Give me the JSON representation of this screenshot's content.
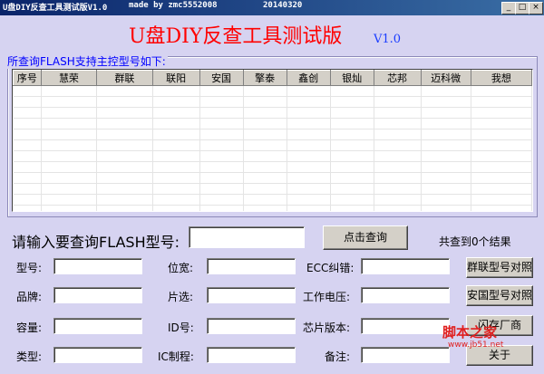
{
  "window": {
    "title": "U盘DIY反查工具测试版V1.0",
    "made_by": "made by zmc5552008",
    "date": "20140320",
    "min_glyph": "_",
    "max_glyph": "□",
    "close_glyph": "×"
  },
  "header": {
    "title": "U盘DIY反查工具测试版",
    "version": "V1.0"
  },
  "list": {
    "label": "所查询FLASH支持主控型号如下:",
    "columns": [
      "序号",
      "慧荣",
      "群联",
      "联阳",
      "安国",
      "擎泰",
      "鑫创",
      "银灿",
      "芯邦",
      "迈科微",
      "我想"
    ]
  },
  "query": {
    "prompt": "请输入要查询FLASH型号:",
    "input_value": "",
    "button": "点击查询",
    "result": "共查到0个结果"
  },
  "fields": {
    "model": "型号:",
    "width": "位宽:",
    "ecc": "ECC纠错:",
    "brand": "品牌:",
    "chip_select": "片选:",
    "voltage": "工作电压:",
    "capacity": "容量:",
    "id": "ID号:",
    "chip_version": "芯片版本:",
    "type": "类型:",
    "ic_process": "IC制程:",
    "remark": "备注:"
  },
  "side_buttons": {
    "phison": "群联型号对照",
    "alcor": "安国型号对照",
    "third": "闪存厂商",
    "about": "关于"
  },
  "watermark": {
    "text": "脚本之家",
    "url": "www.jb51.net"
  }
}
